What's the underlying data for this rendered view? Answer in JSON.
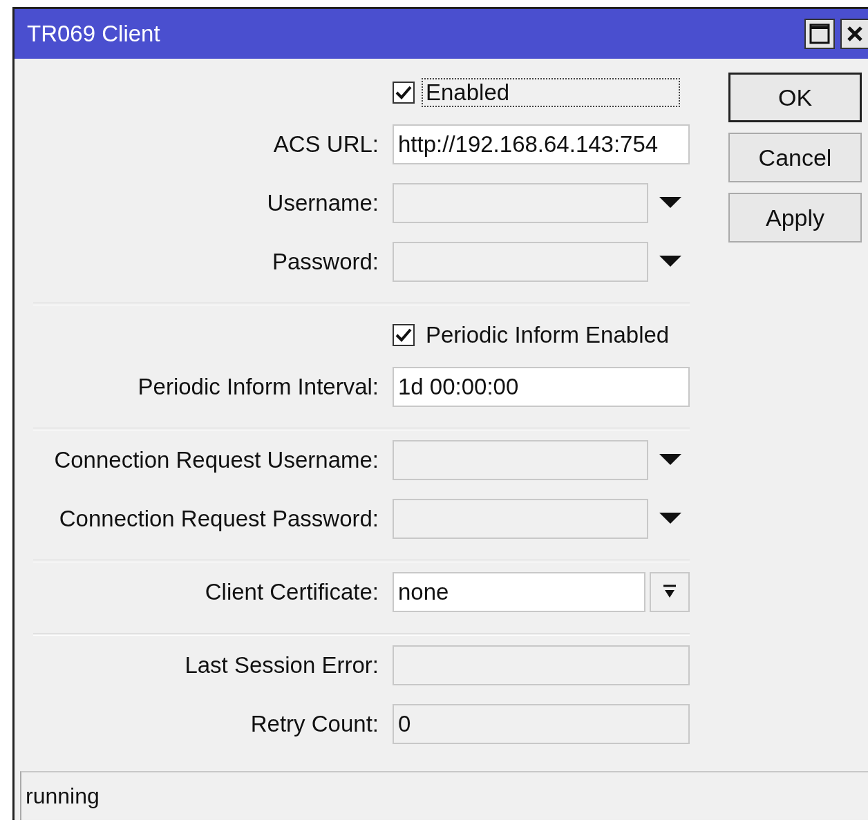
{
  "window": {
    "title": "TR069 Client"
  },
  "fields": [
    {
      "kind": "checkbox",
      "text": "Enabled",
      "checked": true,
      "focused": true
    },
    {
      "kind": "text",
      "label": "ACS URL:",
      "value": "http://192.168.64.143:754"
    },
    {
      "kind": "dropdown",
      "label": "Username:"
    },
    {
      "kind": "dropdown",
      "label": "Password:"
    },
    {
      "kind": "separator"
    },
    {
      "kind": "checkbox",
      "text": "Periodic Inform Enabled",
      "checked": true,
      "focused": false
    },
    {
      "kind": "text",
      "label": "Periodic Inform Interval:",
      "value": "1d 00:00:00"
    },
    {
      "kind": "separator"
    },
    {
      "kind": "dropdown",
      "label": "Connection Request Username:"
    },
    {
      "kind": "dropdown",
      "label": "Connection Request Password:"
    },
    {
      "kind": "separator"
    },
    {
      "kind": "select",
      "label": "Client Certificate:",
      "value": "none"
    },
    {
      "kind": "separator"
    },
    {
      "kind": "readonly",
      "label": "Last Session Error:"
    },
    {
      "kind": "readonly",
      "label": "Retry Count:",
      "value": "0"
    }
  ],
  "buttons": [
    {
      "label": "OK",
      "default": true
    },
    {
      "label": "Cancel",
      "default": false
    },
    {
      "label": "Apply",
      "default": false
    }
  ],
  "status_bar": {
    "text": "running"
  }
}
